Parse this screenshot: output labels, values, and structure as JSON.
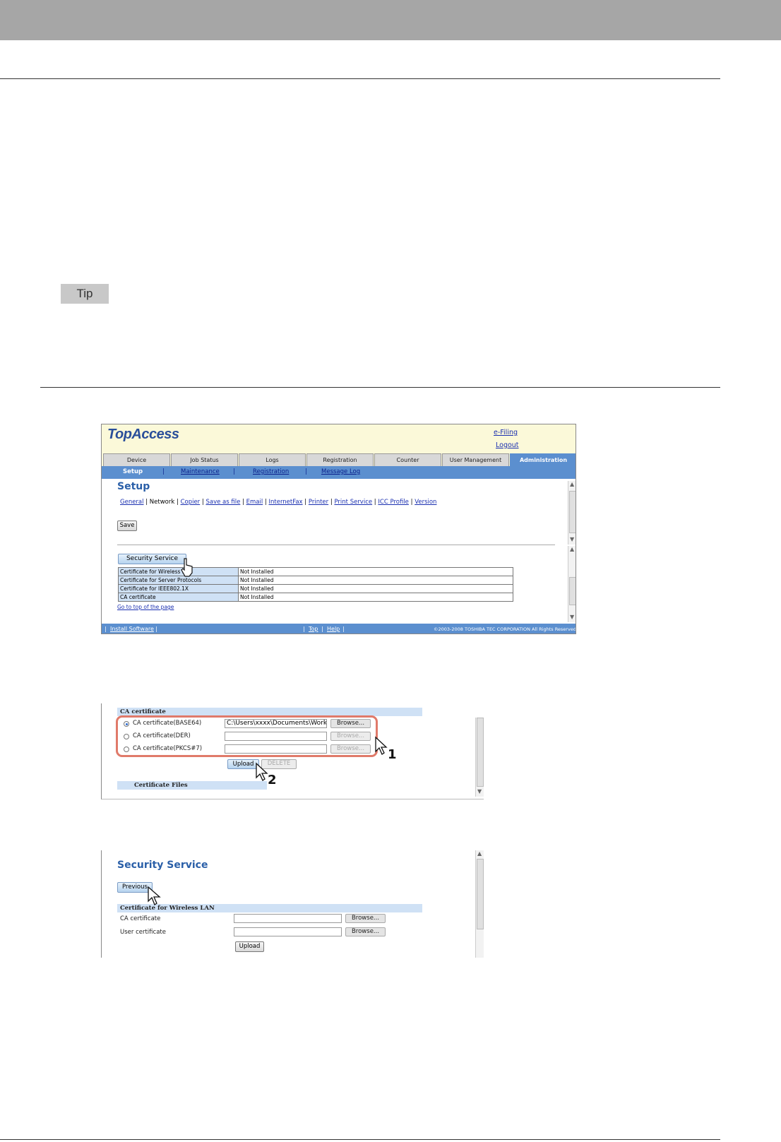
{
  "tip_label": "Tip",
  "shot1": {
    "logo": "TopAccess",
    "links": [
      "e-Filing",
      "Logout"
    ],
    "tabs": [
      "Device",
      "Job Status",
      "Logs",
      "Registration",
      "Counter",
      "User Management",
      "Administration"
    ],
    "active_tab": "Administration",
    "subnav": [
      "Setup",
      "Maintenance",
      "Registration",
      "Message Log"
    ],
    "title": "Setup",
    "setup_links": [
      "General",
      "Network",
      "Copier",
      "Save as file",
      "Email",
      "InternetFax",
      "Printer",
      "Print Service",
      "ICC Profile",
      "Version"
    ],
    "current_link": "Network",
    "save_label": "Save",
    "security_button": "Security Service",
    "certs": [
      {
        "name": "Certificate for Wireless LAN",
        "status": "Not Installed"
      },
      {
        "name": "Certificate for Server Protocols",
        "status": "Not Installed"
      },
      {
        "name": "Certificate for IEEE802.1X",
        "status": "Not Installed"
      },
      {
        "name": "CA certificate",
        "status": "Not Installed"
      }
    ],
    "goto_top": "Go to top of the page",
    "footer_install": "Install Software",
    "footer_top": "Top",
    "footer_help": "Help",
    "copyright": "©2003-2008 TOSHIBA TEC CORPORATION All Rights Reserved"
  },
  "shot2": {
    "section": "CA certificate",
    "options": [
      {
        "label": "CA certificate(BASE64)",
        "value": "C:\\Users\\xxxx\\Documents\\Work_Ir",
        "selected": true
      },
      {
        "label": "CA certificate(DER)",
        "value": "",
        "selected": false
      },
      {
        "label": "CA certificate(PKCS#7)",
        "value": "",
        "selected": false
      }
    ],
    "browse_label": "Browse...",
    "upload_label": "Upload",
    "delete_label": "DELETE",
    "files_section": "Certificate Files",
    "step1": "1",
    "step2": "2"
  },
  "shot3": {
    "title": "Security Service",
    "previous_label": "Previous",
    "section": "Certificate for Wireless LAN",
    "rows": [
      "CA certificate",
      "User certificate"
    ],
    "browse_label": "Browse...",
    "upload_label": "Upload"
  }
}
